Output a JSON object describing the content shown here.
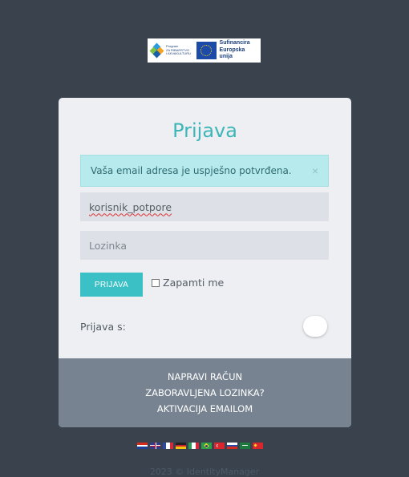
{
  "logo": {
    "program_text": [
      "Program",
      "ZA RIBARSTVO",
      "I AKVAKULTURU"
    ],
    "eu_text": [
      "Sufinancira",
      "Europska unija"
    ]
  },
  "card": {
    "title": "Prijava",
    "alert": {
      "message": "Vaša email adresa je uspješno potvrđena.",
      "close": "×"
    },
    "username": {
      "value": "korisnik_potpore"
    },
    "password": {
      "placeholder": "Lozinka"
    },
    "login_button": "PRIJAVA",
    "remember_label": "Zapamti me",
    "login_with": "Prijava s:"
  },
  "footer": {
    "links": [
      "NAPRAVI RAČUN",
      "ZABORAVLJENA LOZINKA?",
      "AKTIVACIJA EMAILOM"
    ]
  },
  "languages": [
    "hr",
    "en",
    "fr",
    "de",
    "it",
    "pt-br",
    "tr",
    "ru",
    "sa",
    "cn"
  ],
  "copyright": "2023 © IdentityManager",
  "colors": {
    "background": "#39424d",
    "accent": "#3ac0c5",
    "alert_bg": "#b6eaec",
    "footer_bg": "#778391"
  }
}
